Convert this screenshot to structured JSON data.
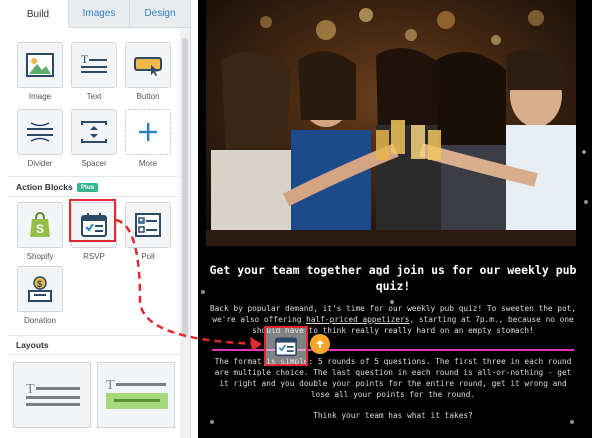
{
  "tabs": [
    "Build",
    "Images",
    "Design"
  ],
  "content_blocks": [
    {
      "label": "Image",
      "icon": "image-icon"
    },
    {
      "label": "Text",
      "icon": "text-icon"
    },
    {
      "label": "Button",
      "icon": "button-icon"
    },
    {
      "label": "Divider",
      "icon": "divider-icon"
    },
    {
      "label": "Spacer",
      "icon": "spacer-icon"
    },
    {
      "label": "More",
      "icon": "plus-icon"
    }
  ],
  "action_blocks": {
    "title": "Action Blocks",
    "badge": "Plus",
    "items": [
      {
        "label": "Shopify",
        "icon": "shopify-icon"
      },
      {
        "label": "RSVP",
        "icon": "calendar-check-icon"
      },
      {
        "label": "Poll",
        "icon": "poll-icon"
      },
      {
        "label": "Donation",
        "icon": "donation-icon"
      }
    ]
  },
  "layouts": {
    "title": "Layouts"
  },
  "email": {
    "headline": "Get your team together and join us for our weekly pub quiz!",
    "para1_a": "Back by popular demand, it's time for our weekly pub quiz! To sweeten the pot, we're also offering ",
    "para1_link": "half-priced appetizers",
    "para1_b": ", starting at 7p.m., because no one should have to think really really hard on an empty stomach!",
    "para2": "The format is simple: 5 rounds of 5 questions. The first three in each round are multiple choice. The last question in each round is all-or-nothing - get it right and you double your points for the entire round, get it wrong and lose all your points for the round.",
    "para3": "Think your team has what it takes?"
  },
  "colors": {
    "accent_blue": "#2f7fc1",
    "highlight_red": "#e02a30",
    "drop_line": "#e232b5",
    "plus_badge": "#35b48f",
    "drop_indicator": "#f5a623"
  }
}
